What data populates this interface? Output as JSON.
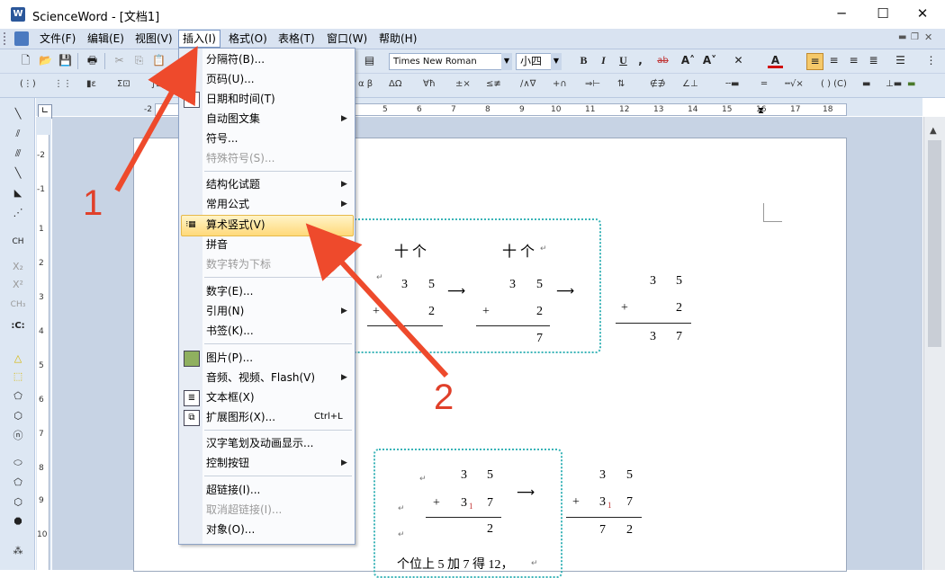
{
  "window": {
    "title": "ScienceWord - [文档1]"
  },
  "menubar": {
    "items": [
      {
        "label": "文件(F)"
      },
      {
        "label": "编辑(E)"
      },
      {
        "label": "视图(V)"
      },
      {
        "label": "插入(I)"
      },
      {
        "label": "格式(O)"
      },
      {
        "label": "表格(T)"
      },
      {
        "label": "窗口(W)"
      },
      {
        "label": "帮助(H)"
      }
    ]
  },
  "toolbar": {
    "font_name": "Times New Roman",
    "font_size": "小四"
  },
  "ruler": {
    "h_ticks": [
      "-2",
      "5",
      "6",
      "7",
      "8",
      "9",
      "10",
      "11",
      "12",
      "13",
      "14",
      "15",
      "16",
      "17",
      "18"
    ],
    "v_ticks": [
      "-2",
      "-1",
      "1",
      "2",
      "3",
      "4",
      "5",
      "6",
      "7",
      "8",
      "9",
      "10"
    ]
  },
  "insert_menu": {
    "items": [
      {
        "label": "分隔符(B)..."
      },
      {
        "label": "页码(U)..."
      },
      {
        "label": "日期和时间(T)"
      },
      {
        "label": "自动图文集"
      },
      {
        "label": "符号..."
      },
      {
        "label": "特殊符号(S)..."
      },
      {
        "label": "结构化试题"
      },
      {
        "label": "常用公式"
      },
      {
        "label": "算术竖式(V)"
      },
      {
        "label": "拼音"
      },
      {
        "label": "数字转为下标"
      },
      {
        "label": "数字(E)..."
      },
      {
        "label": "引用(N)"
      },
      {
        "label": "书签(K)..."
      },
      {
        "label": "图片(P)..."
      },
      {
        "label": "音频、视频、Flash(V)"
      },
      {
        "label": "文本框(X)"
      },
      {
        "label": "扩展图形(X)..."
      },
      {
        "label": "汉字笔划及动画显示..."
      },
      {
        "label": "控制按钮"
      },
      {
        "label": "超链接(I)..."
      },
      {
        "label": "取消超链接(I)..."
      },
      {
        "label": "对象(O)..."
      }
    ],
    "shortcut_ext_shape": "Ctrl+L"
  },
  "document": {
    "block1": {
      "header1": "十 个",
      "header2": "十 个",
      "a1": "3",
      "b1": "5",
      "op1": "+",
      "c1": "2",
      "a2": "3",
      "b2": "5",
      "op2": "+",
      "c2": "2",
      "r2": "7",
      "a3": "3",
      "b3": "5",
      "op3": "+",
      "c3": "2",
      "r3a": "3",
      "r3b": "7"
    },
    "block2": {
      "a": "3",
      "b": "5",
      "op": "+",
      "c": "3",
      "cs": "1",
      "d": "7",
      "r": "2",
      "a2": "3",
      "b2": "5",
      "op2": "+",
      "c2": "3",
      "cs2": "1",
      "d2": "7",
      "r2a": "7",
      "r2b": "2",
      "text": "个位上 5 加 7 得 12，"
    }
  },
  "annotations": {
    "step1": "1",
    "step2": "2"
  }
}
